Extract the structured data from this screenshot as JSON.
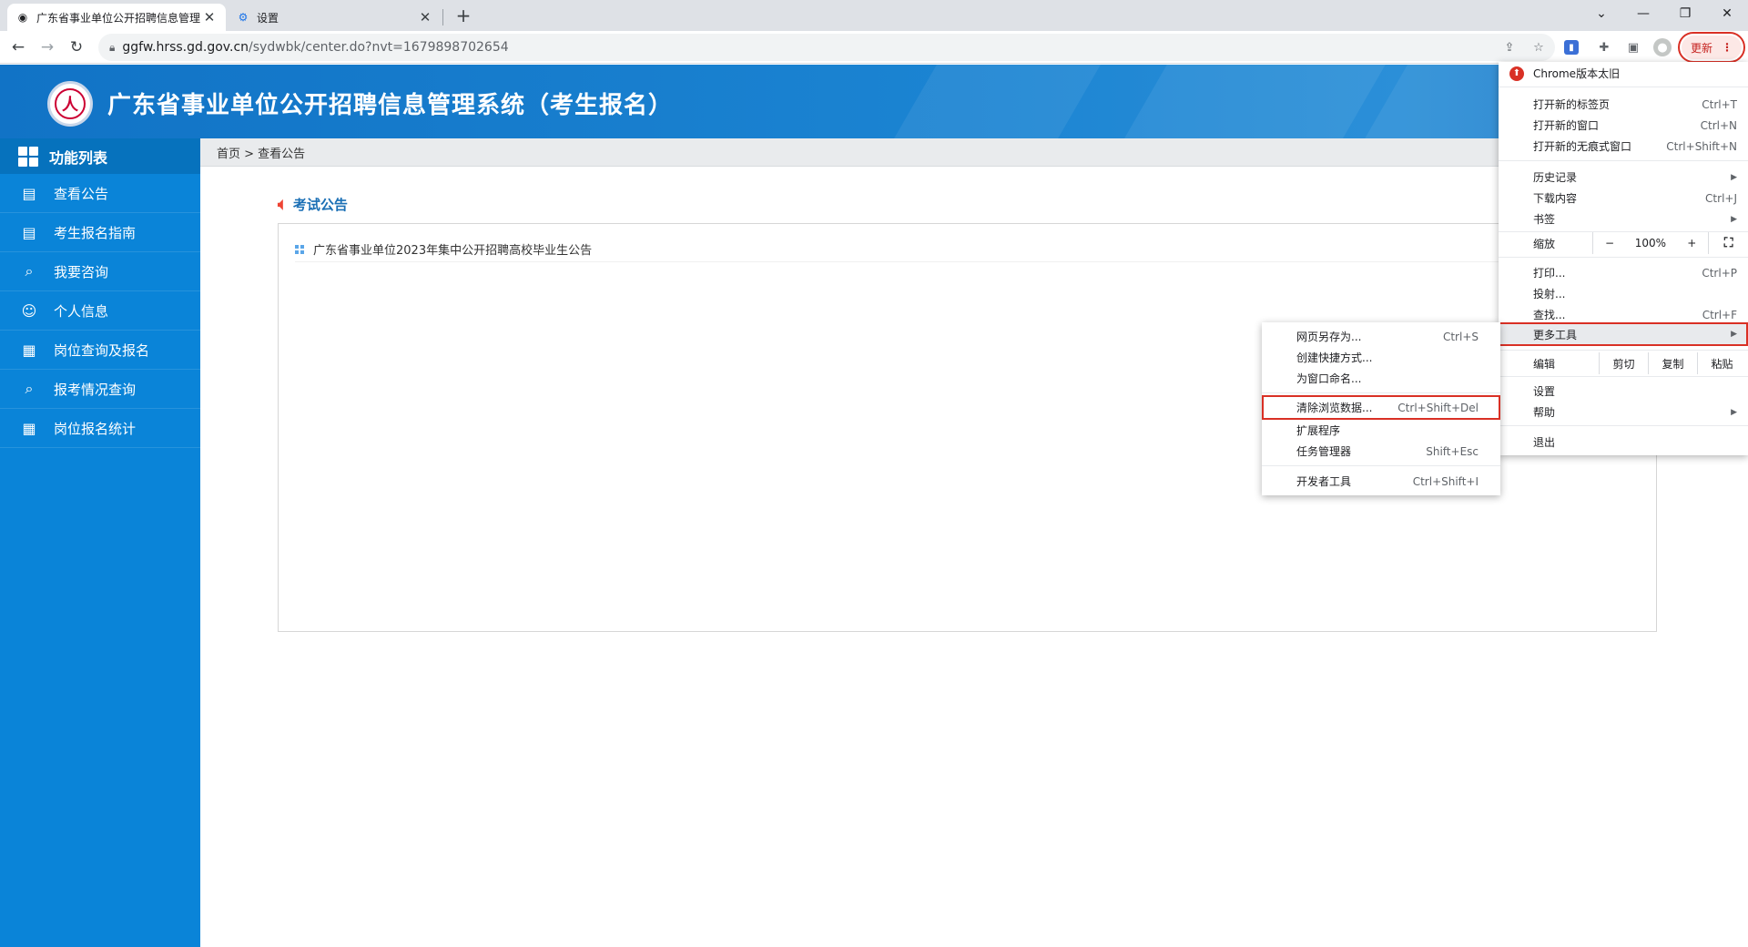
{
  "browser": {
    "tabs": [
      {
        "title": "广东省事业单位公开招聘信息管理",
        "active": true
      },
      {
        "title": "设置",
        "active": false
      }
    ],
    "url_domain": "ggfw.hrss.gd.gov.cn",
    "url_path": "/sydwbk/center.do?nvt=1679898702654",
    "update_label": "更新",
    "icons": [
      "back-icon",
      "forward-icon",
      "reload-icon",
      "lock-icon",
      "share-icon",
      "star-icon",
      "extension-icon",
      "puzzle-icon",
      "side-panel-icon",
      "profile-icon",
      "menu-dots-icon"
    ]
  },
  "chrome_menu": {
    "old_version_notice": "Chrome版本太旧",
    "new_tab": {
      "label": "打开新的标签页",
      "shortcut": "Ctrl+T"
    },
    "new_window": {
      "label": "打开新的窗口",
      "shortcut": "Ctrl+N"
    },
    "incognito": {
      "label": "打开新的无痕式窗口",
      "shortcut": "Ctrl+Shift+N"
    },
    "history": {
      "label": "历史记录"
    },
    "downloads": {
      "label": "下载内容",
      "shortcut": "Ctrl+J"
    },
    "bookmarks": {
      "label": "书签"
    },
    "zoom": {
      "label": "缩放",
      "minus": "−",
      "value": "100%",
      "plus": "+"
    },
    "print": {
      "label": "打印...",
      "shortcut": "Ctrl+P"
    },
    "cast": {
      "label": "投射..."
    },
    "find": {
      "label": "查找...",
      "shortcut": "Ctrl+F"
    },
    "more_tools": {
      "label": "更多工具"
    },
    "edit": {
      "label": "编辑",
      "cut": "剪切",
      "copy": "复制",
      "paste": "粘贴"
    },
    "settings": {
      "label": "设置"
    },
    "help": {
      "label": "帮助"
    },
    "exit": {
      "label": "退出"
    }
  },
  "more_tools_menu": {
    "save_page": {
      "label": "网页另存为...",
      "shortcut": "Ctrl+S"
    },
    "create_shortcut": {
      "label": "创建快捷方式..."
    },
    "name_window": {
      "label": "为窗口命名..."
    },
    "clear_data": {
      "label": "清除浏览数据...",
      "shortcut": "Ctrl+Shift+Del"
    },
    "extensions": {
      "label": "扩展程序"
    },
    "task_manager": {
      "label": "任务管理器",
      "shortcut": "Shift+Esc"
    },
    "dev_tools": {
      "label": "开发者工具",
      "shortcut": "Ctrl+Shift+I"
    }
  },
  "page": {
    "banner_title": "广东省事业单位公开招聘信息管理系统（考生报名）",
    "sidebar": {
      "heading": "功能列表",
      "items": [
        {
          "label": "查看公告"
        },
        {
          "label": "考生报名指南"
        },
        {
          "label": "我要咨询"
        },
        {
          "label": "个人信息"
        },
        {
          "label": "岗位查询及报名"
        },
        {
          "label": "报考情况查询"
        },
        {
          "label": "岗位报名统计"
        }
      ]
    },
    "breadcrumb": "首页 > 查看公告",
    "notice_heading": "考试公告",
    "notices": [
      {
        "title": "广东省事业单位2023年集中公开招聘高校毕业生公告"
      }
    ]
  }
}
